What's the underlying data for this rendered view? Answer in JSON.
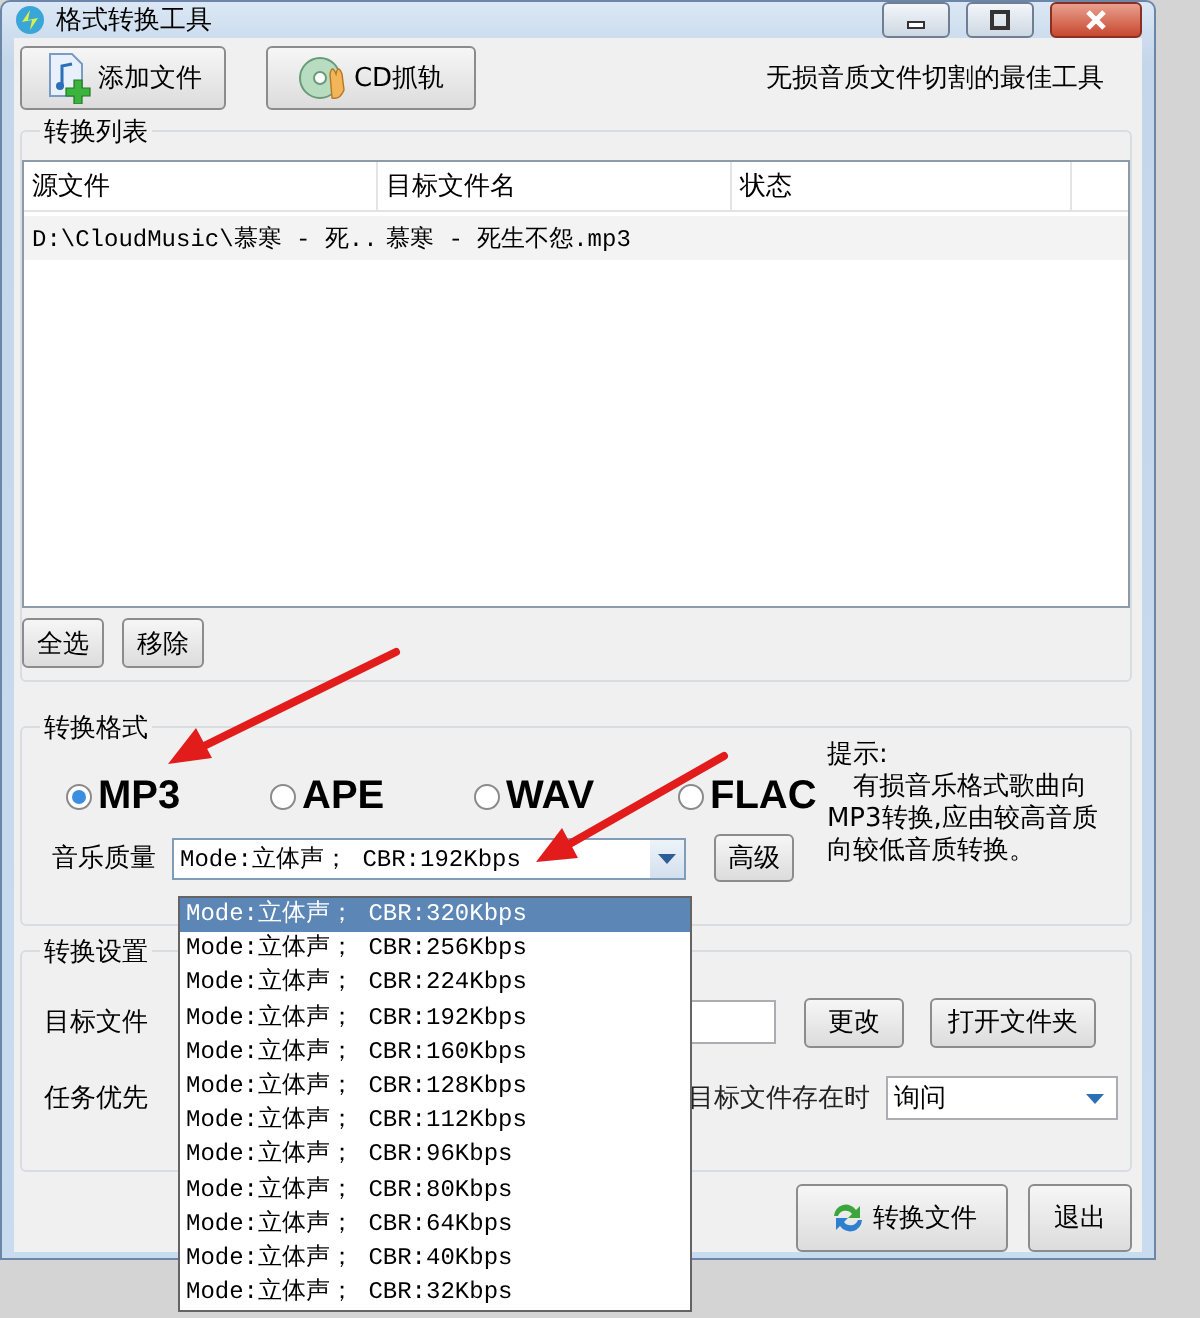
{
  "window": {
    "title": "格式转换工具"
  },
  "toolbar": {
    "buttons": [
      {
        "label": "添加文件",
        "kind": "add"
      },
      {
        "label": "CD抓轨",
        "kind": "cd"
      }
    ],
    "tagline": "无损音质文件切割的最佳工具"
  },
  "convert_list": {
    "title": "转换列表",
    "columns": [
      "源文件",
      "目标文件名",
      "状态"
    ],
    "rows": [
      [
        "D:\\CloudMusic\\慕寒 - 死..",
        "慕寒 - 死生不怨.mp3"
      ]
    ],
    "buttons": [
      "全选",
      "移除"
    ]
  },
  "format": {
    "title": "转换格式",
    "options": [
      {
        "label": "MP3",
        "selected": true
      },
      {
        "label": "APE",
        "selected": false
      },
      {
        "label": "WAV",
        "selected": false
      },
      {
        "label": "FLAC",
        "selected": false
      }
    ],
    "quality_label": "音乐质量",
    "quality_value": "Mode:立体声； CBR:192Kbps",
    "advanced_button": "高级",
    "tip_title": "提示:",
    "tip": "有损音乐格式歌曲向MP3转换,应由较高音质向较低音质转换。"
  },
  "settings": {
    "title": "转换设置",
    "folder_label": "目标文件",
    "buttons": [
      "更改",
      "打开文件夹"
    ],
    "priority_label": "任务优先",
    "exists_label": "目标文件存在时",
    "exists_value": "询问"
  },
  "actions": [
    {
      "label": "转换文件",
      "kind": "convert"
    },
    {
      "label": "退出",
      "kind": "plain"
    }
  ],
  "dropdown": {
    "items": [
      {
        "label": "Mode:立体声； CBR:320Kbps",
        "selected": true
      },
      {
        "label": "Mode:立体声； CBR:256Kbps",
        "selected": false
      },
      {
        "label": "Mode:立体声； CBR:224Kbps",
        "selected": false
      },
      {
        "label": "Mode:立体声； CBR:192Kbps",
        "selected": false
      },
      {
        "label": "Mode:立体声； CBR:160Kbps",
        "selected": false
      },
      {
        "label": "Mode:立体声； CBR:128Kbps",
        "selected": false
      },
      {
        "label": "Mode:立体声； CBR:112Kbps",
        "selected": false
      },
      {
        "label": "Mode:立体声； CBR:96Kbps",
        "selected": false
      },
      {
        "label": "Mode:立体声； CBR:80Kbps",
        "selected": false
      },
      {
        "label": "Mode:立体声； CBR:64Kbps",
        "selected": false
      },
      {
        "label": "Mode:立体声； CBR:40Kbps",
        "selected": false
      },
      {
        "label": "Mode:立体声； CBR:32Kbps",
        "selected": false
      }
    ]
  }
}
